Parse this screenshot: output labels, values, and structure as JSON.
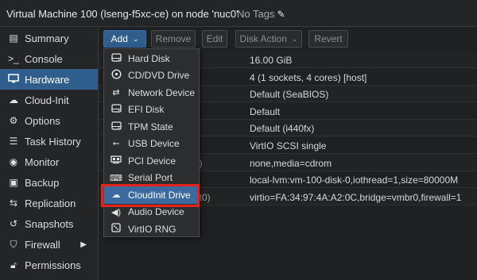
{
  "header": {
    "vm_title": "Virtual Machine 100 (lseng-f5xc-ce) on node 'nuc0'",
    "tags_label": "No Tags",
    "edit_tags_icon": "pencil-icon"
  },
  "sidebar": {
    "items": [
      {
        "label": "Summary",
        "icon": "summary-icon"
      },
      {
        "label": "Console",
        "icon": "console-icon"
      },
      {
        "label": "Hardware",
        "icon": "monitor-icon",
        "active": true
      },
      {
        "label": "Cloud-Init",
        "icon": "cloud-icon"
      },
      {
        "label": "Options",
        "icon": "gear-icon"
      },
      {
        "label": "Task History",
        "icon": "list-icon"
      },
      {
        "label": "Monitor",
        "icon": "eye-icon"
      },
      {
        "label": "Backup",
        "icon": "save-icon"
      },
      {
        "label": "Replication",
        "icon": "retweet-icon"
      },
      {
        "label": "Snapshots",
        "icon": "history-icon"
      },
      {
        "label": "Firewall",
        "icon": "shield-icon"
      },
      {
        "label": "Permissions",
        "icon": "unlock-icon"
      }
    ]
  },
  "toolbar": {
    "add_label": "Add",
    "remove_label": "Remove",
    "edit_label": "Edit",
    "disk_action_label": "Disk Action",
    "revert_label": "Revert"
  },
  "grid": {
    "rows": [
      {
        "label": "",
        "value": "16.00 GiB"
      },
      {
        "label": "",
        "value": "4 (1 sockets, 4 cores) [host]"
      },
      {
        "label": "",
        "value": "Default (SeaBIOS)"
      },
      {
        "label": "",
        "value": "Default"
      },
      {
        "label": "",
        "value": "Default (i440fx)"
      },
      {
        "label": "",
        "value": "VirtIO SCSI single"
      },
      {
        "label": "2)",
        "value": "none,media=cdrom"
      },
      {
        "label": "",
        "value": "local-lvm:vm-100-disk-0,iothread=1,size=80000M"
      },
      {
        "label": "et0)",
        "value": "virtio=FA:34:97:4A:A2:0C,bridge=vmbr0,firewall=1"
      }
    ]
  },
  "add_menu": {
    "items": [
      {
        "label": "Hard Disk",
        "icon": "hdd-icon"
      },
      {
        "label": "CD/DVD Drive",
        "icon": "cdrom-icon"
      },
      {
        "label": "Network Device",
        "icon": "exchange-icon"
      },
      {
        "label": "EFI Disk",
        "icon": "hdd-icon"
      },
      {
        "label": "TPM State",
        "icon": "hdd-icon"
      },
      {
        "label": "USB Device",
        "icon": "usb-icon"
      },
      {
        "label": "PCI Device",
        "icon": "pci-icon"
      },
      {
        "label": "Serial Port",
        "icon": "keyboard-icon"
      },
      {
        "label": "CloudInit Drive",
        "icon": "cloud-icon",
        "highlighted": true
      },
      {
        "label": "Audio Device",
        "icon": "speaker-icon"
      },
      {
        "label": "VirtIO RNG",
        "icon": "dice-icon"
      }
    ]
  },
  "colors": {
    "accent": "#2f5d8c",
    "annotation": "#e5231b"
  }
}
